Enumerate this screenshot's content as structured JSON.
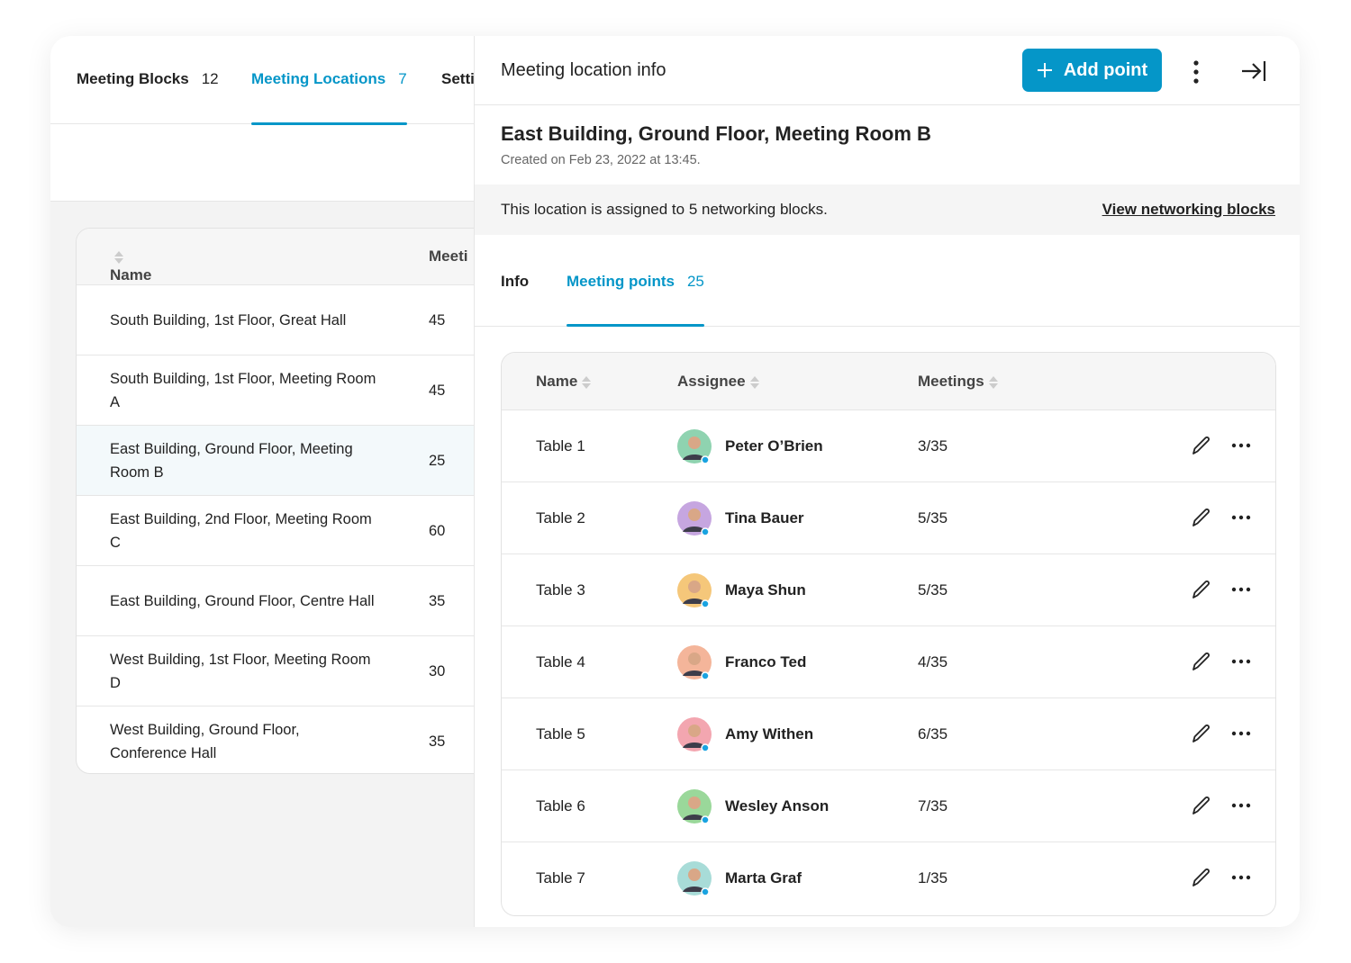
{
  "left_panel": {
    "tabs": [
      {
        "label": "Meeting Blocks",
        "count": "12"
      },
      {
        "label": "Meeting Locations",
        "count": "7"
      },
      {
        "label": "Setti"
      }
    ],
    "table": {
      "headers": [
        "Name",
        "Meeti"
      ],
      "rows": [
        {
          "name": "South Building, 1st Floor, Great Hall",
          "meetings": "45"
        },
        {
          "name": "South Building, 1st Floor, Meeting Room A",
          "meetings": "45"
        },
        {
          "name": "East Building, Ground Floor, Meeting Room B",
          "meetings": "25"
        },
        {
          "name": "East Building, 2nd Floor, Meeting Room C",
          "meetings": "60"
        },
        {
          "name": "East Building, Ground Floor, Centre Hall",
          "meetings": "35"
        },
        {
          "name": "West Building, 1st Floor, Meeting Room D",
          "meetings": "30"
        },
        {
          "name": "West Building, Ground Floor, Conference Hall",
          "meetings": "35"
        }
      ]
    }
  },
  "right_panel": {
    "title": "Meeting location info",
    "add_button": "Add point",
    "location_name": "East Building, Ground Floor, Meeting Room B",
    "created": "Created on Feb 23, 2022 at 13:45.",
    "banner_text": "This location is assigned to 5 networking blocks.",
    "banner_link": "View networking blocks",
    "tabs": [
      {
        "label": "Info"
      },
      {
        "label": "Meeting points",
        "count": "25"
      }
    ],
    "table": {
      "headers": [
        "Name",
        "Assignee",
        "Meetings"
      ],
      "rows": [
        {
          "name": "Table 1",
          "assignee": "Peter O’Brien",
          "meetings": "3/35",
          "avatar_color": "#8fd3b0"
        },
        {
          "name": "Table 2",
          "assignee": "Tina Bauer",
          "meetings": "5/35",
          "avatar_color": "#c6a6e0"
        },
        {
          "name": "Table 3",
          "assignee": "Maya Shun",
          "meetings": "5/35",
          "avatar_color": "#f5c77a"
        },
        {
          "name": "Table 4",
          "assignee": "Franco Ted",
          "meetings": "4/35",
          "avatar_color": "#f4b59a"
        },
        {
          "name": "Table 5",
          "assignee": "Amy Withen",
          "meetings": "6/35",
          "avatar_color": "#f3a6b0"
        },
        {
          "name": "Table 6",
          "assignee": "Wesley Anson",
          "meetings": "7/35",
          "avatar_color": "#9ad89a"
        },
        {
          "name": "Table 7",
          "assignee": "Marta Graf",
          "meetings": "1/35",
          "avatar_color": "#a8dcd8"
        }
      ]
    }
  },
  "colors": {
    "accent": "#0596c8",
    "online_dot": "#1aa3e0"
  }
}
